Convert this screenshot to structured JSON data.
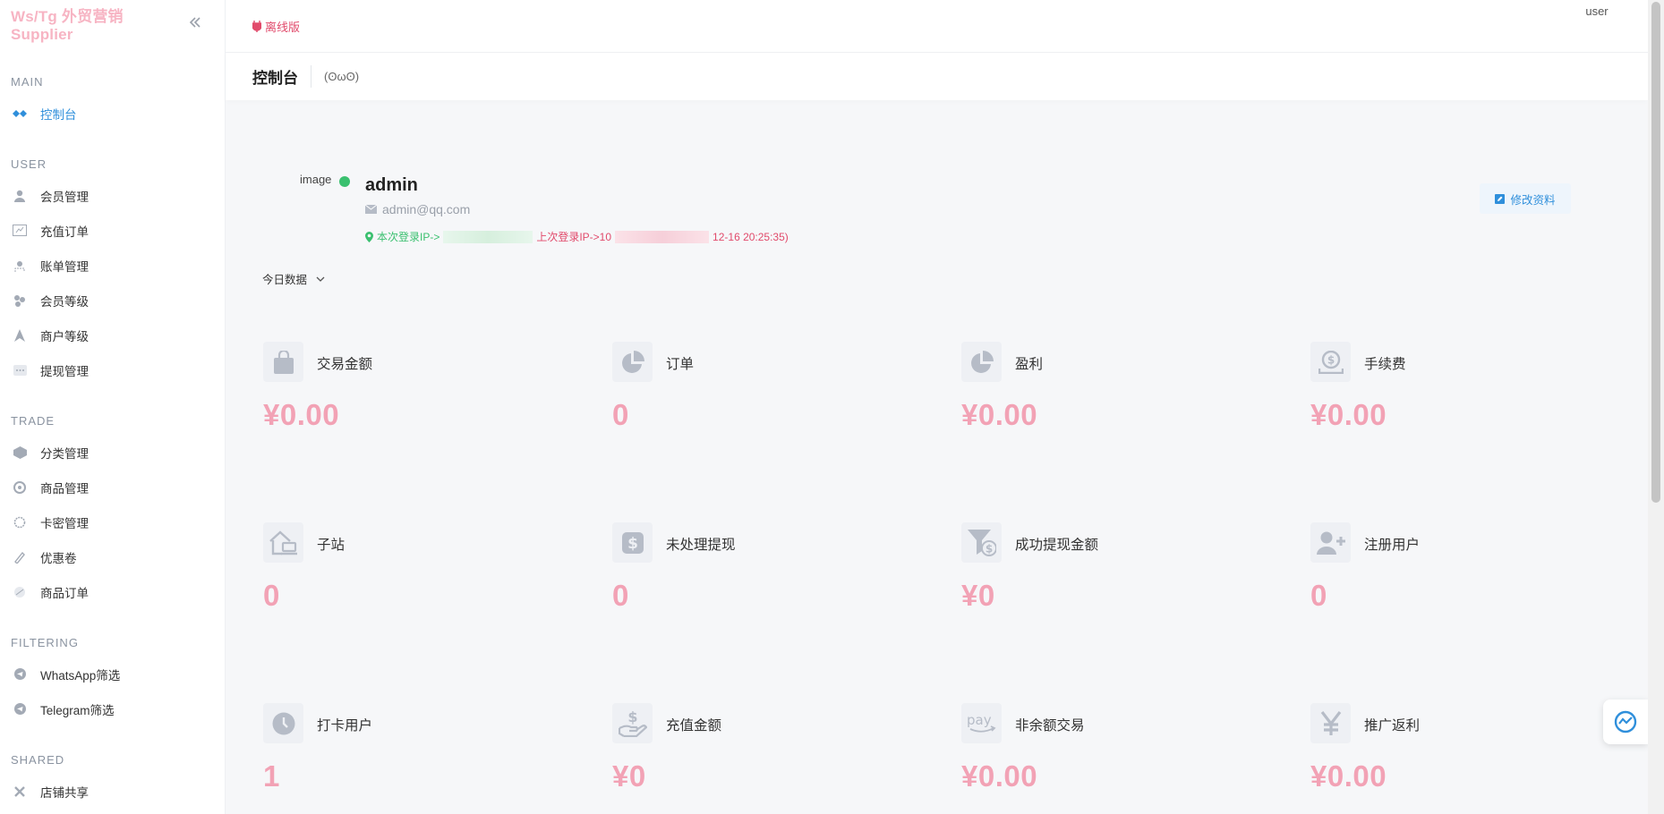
{
  "brand": {
    "title": "Ws/Tg 外贸营销 Supplier",
    "collapse_icon": "double-chevron-left-icon"
  },
  "sidebar": {
    "sections": [
      {
        "title": "MAIN",
        "items": [
          {
            "label": "控制台",
            "icon": "dashboard-icon",
            "active": true
          }
        ]
      },
      {
        "title": "USER",
        "items": [
          {
            "label": "会员管理",
            "icon": "user-icon"
          },
          {
            "label": "充值订单",
            "icon": "recharge-icon"
          },
          {
            "label": "账单管理",
            "icon": "bill-icon"
          },
          {
            "label": "会员等级",
            "icon": "level-icon"
          },
          {
            "label": "商户等级",
            "icon": "merchant-icon"
          },
          {
            "label": "提现管理",
            "icon": "withdraw-icon"
          }
        ]
      },
      {
        "title": "TRADE",
        "items": [
          {
            "label": "分类管理",
            "icon": "category-icon"
          },
          {
            "label": "商品管理",
            "icon": "goods-icon"
          },
          {
            "label": "卡密管理",
            "icon": "card-icon"
          },
          {
            "label": "优惠卷",
            "icon": "coupon-icon"
          },
          {
            "label": "商品订单",
            "icon": "order-icon"
          }
        ]
      },
      {
        "title": "FILTERING",
        "items": [
          {
            "label": "WhatsApp筛选",
            "icon": "telegram-icon"
          },
          {
            "label": "Telegram筛选",
            "icon": "telegram-icon"
          }
        ]
      },
      {
        "title": "SHARED",
        "items": [
          {
            "label": "店铺共享",
            "icon": "share-icon"
          }
        ]
      }
    ]
  },
  "topbar": {
    "mode_label": "离线版",
    "user_img_alt": "user"
  },
  "page": {
    "title": "控制台",
    "subtitle": "(ʘωʘ)"
  },
  "profile": {
    "img_alt": "image",
    "name": "admin",
    "email": "admin@qq.com",
    "current_ip_label": "本次登录IP->",
    "last_ip_label": "上次登录IP->10",
    "last_ip_suffix": "12-16 20:25:35)",
    "edit_label": "修改资料"
  },
  "filter": {
    "label": "今日数据"
  },
  "stats": [
    {
      "label": "交易金额",
      "value": "¥0.00",
      "icon": "bag-icon"
    },
    {
      "label": "订单",
      "value": "0",
      "icon": "pie-icon"
    },
    {
      "label": "盈利",
      "value": "¥0.00",
      "icon": "pie-icon"
    },
    {
      "label": "手续费",
      "value": "¥0.00",
      "icon": "coin-icon"
    },
    {
      "label": "子站",
      "value": "0",
      "icon": "house-icon"
    },
    {
      "label": "未处理提现",
      "value": "0",
      "icon": "dollar-box-icon"
    },
    {
      "label": "成功提现金额",
      "value": "¥0",
      "icon": "funnel-dollar-icon"
    },
    {
      "label": "注册用户",
      "value": "0",
      "icon": "user-plus-icon"
    },
    {
      "label": "打卡用户",
      "value": "1",
      "icon": "clock-icon"
    },
    {
      "label": "充值金额",
      "value": "¥0",
      "icon": "hand-dollar-icon"
    },
    {
      "label": "非余额交易",
      "value": "¥0.00",
      "icon": "pay-icon"
    },
    {
      "label": "推广返利",
      "value": "¥0.00",
      "icon": "yen-icon"
    }
  ],
  "colors": {
    "brand": "#f7b4c3",
    "accent": "#2f8fdb",
    "value": "#f2a2b5",
    "online": "#3ac06f",
    "danger": "#e14a6b"
  }
}
